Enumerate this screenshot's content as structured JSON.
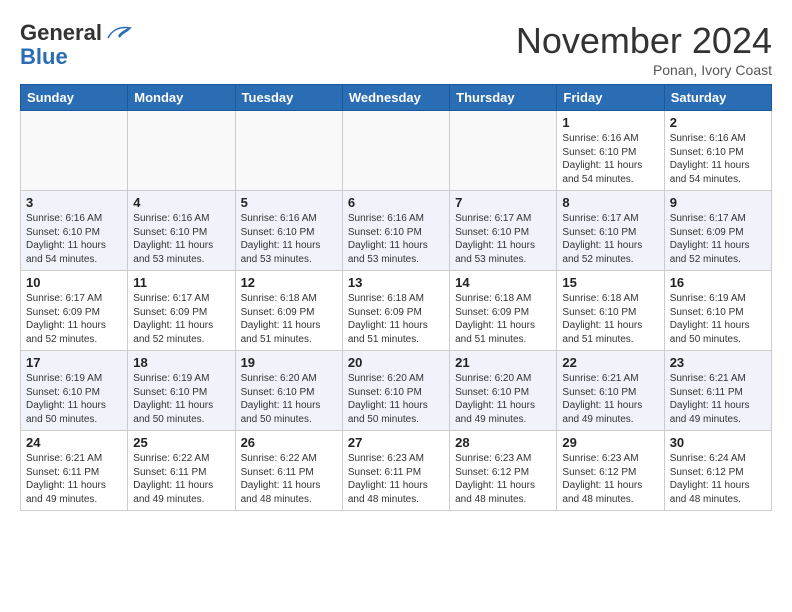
{
  "header": {
    "logo_line1": "General",
    "logo_line2": "Blue",
    "month_title": "November 2024",
    "subtitle": "Ponan, Ivory Coast"
  },
  "weekdays": [
    "Sunday",
    "Monday",
    "Tuesday",
    "Wednesday",
    "Thursday",
    "Friday",
    "Saturday"
  ],
  "weeks": [
    [
      {
        "day": "",
        "detail": ""
      },
      {
        "day": "",
        "detail": ""
      },
      {
        "day": "",
        "detail": ""
      },
      {
        "day": "",
        "detail": ""
      },
      {
        "day": "",
        "detail": ""
      },
      {
        "day": "1",
        "detail": "Sunrise: 6:16 AM\nSunset: 6:10 PM\nDaylight: 11 hours\nand 54 minutes."
      },
      {
        "day": "2",
        "detail": "Sunrise: 6:16 AM\nSunset: 6:10 PM\nDaylight: 11 hours\nand 54 minutes."
      }
    ],
    [
      {
        "day": "3",
        "detail": "Sunrise: 6:16 AM\nSunset: 6:10 PM\nDaylight: 11 hours\nand 54 minutes."
      },
      {
        "day": "4",
        "detail": "Sunrise: 6:16 AM\nSunset: 6:10 PM\nDaylight: 11 hours\nand 53 minutes."
      },
      {
        "day": "5",
        "detail": "Sunrise: 6:16 AM\nSunset: 6:10 PM\nDaylight: 11 hours\nand 53 minutes."
      },
      {
        "day": "6",
        "detail": "Sunrise: 6:16 AM\nSunset: 6:10 PM\nDaylight: 11 hours\nand 53 minutes."
      },
      {
        "day": "7",
        "detail": "Sunrise: 6:17 AM\nSunset: 6:10 PM\nDaylight: 11 hours\nand 53 minutes."
      },
      {
        "day": "8",
        "detail": "Sunrise: 6:17 AM\nSunset: 6:10 PM\nDaylight: 11 hours\nand 52 minutes."
      },
      {
        "day": "9",
        "detail": "Sunrise: 6:17 AM\nSunset: 6:09 PM\nDaylight: 11 hours\nand 52 minutes."
      }
    ],
    [
      {
        "day": "10",
        "detail": "Sunrise: 6:17 AM\nSunset: 6:09 PM\nDaylight: 11 hours\nand 52 minutes."
      },
      {
        "day": "11",
        "detail": "Sunrise: 6:17 AM\nSunset: 6:09 PM\nDaylight: 11 hours\nand 52 minutes."
      },
      {
        "day": "12",
        "detail": "Sunrise: 6:18 AM\nSunset: 6:09 PM\nDaylight: 11 hours\nand 51 minutes."
      },
      {
        "day": "13",
        "detail": "Sunrise: 6:18 AM\nSunset: 6:09 PM\nDaylight: 11 hours\nand 51 minutes."
      },
      {
        "day": "14",
        "detail": "Sunrise: 6:18 AM\nSunset: 6:09 PM\nDaylight: 11 hours\nand 51 minutes."
      },
      {
        "day": "15",
        "detail": "Sunrise: 6:18 AM\nSunset: 6:10 PM\nDaylight: 11 hours\nand 51 minutes."
      },
      {
        "day": "16",
        "detail": "Sunrise: 6:19 AM\nSunset: 6:10 PM\nDaylight: 11 hours\nand 50 minutes."
      }
    ],
    [
      {
        "day": "17",
        "detail": "Sunrise: 6:19 AM\nSunset: 6:10 PM\nDaylight: 11 hours\nand 50 minutes."
      },
      {
        "day": "18",
        "detail": "Sunrise: 6:19 AM\nSunset: 6:10 PM\nDaylight: 11 hours\nand 50 minutes."
      },
      {
        "day": "19",
        "detail": "Sunrise: 6:20 AM\nSunset: 6:10 PM\nDaylight: 11 hours\nand 50 minutes."
      },
      {
        "day": "20",
        "detail": "Sunrise: 6:20 AM\nSunset: 6:10 PM\nDaylight: 11 hours\nand 50 minutes."
      },
      {
        "day": "21",
        "detail": "Sunrise: 6:20 AM\nSunset: 6:10 PM\nDaylight: 11 hours\nand 49 minutes."
      },
      {
        "day": "22",
        "detail": "Sunrise: 6:21 AM\nSunset: 6:10 PM\nDaylight: 11 hours\nand 49 minutes."
      },
      {
        "day": "23",
        "detail": "Sunrise: 6:21 AM\nSunset: 6:11 PM\nDaylight: 11 hours\nand 49 minutes."
      }
    ],
    [
      {
        "day": "24",
        "detail": "Sunrise: 6:21 AM\nSunset: 6:11 PM\nDaylight: 11 hours\nand 49 minutes."
      },
      {
        "day": "25",
        "detail": "Sunrise: 6:22 AM\nSunset: 6:11 PM\nDaylight: 11 hours\nand 49 minutes."
      },
      {
        "day": "26",
        "detail": "Sunrise: 6:22 AM\nSunset: 6:11 PM\nDaylight: 11 hours\nand 48 minutes."
      },
      {
        "day": "27",
        "detail": "Sunrise: 6:23 AM\nSunset: 6:11 PM\nDaylight: 11 hours\nand 48 minutes."
      },
      {
        "day": "28",
        "detail": "Sunrise: 6:23 AM\nSunset: 6:12 PM\nDaylight: 11 hours\nand 48 minutes."
      },
      {
        "day": "29",
        "detail": "Sunrise: 6:23 AM\nSunset: 6:12 PM\nDaylight: 11 hours\nand 48 minutes."
      },
      {
        "day": "30",
        "detail": "Sunrise: 6:24 AM\nSunset: 6:12 PM\nDaylight: 11 hours\nand 48 minutes."
      }
    ]
  ]
}
